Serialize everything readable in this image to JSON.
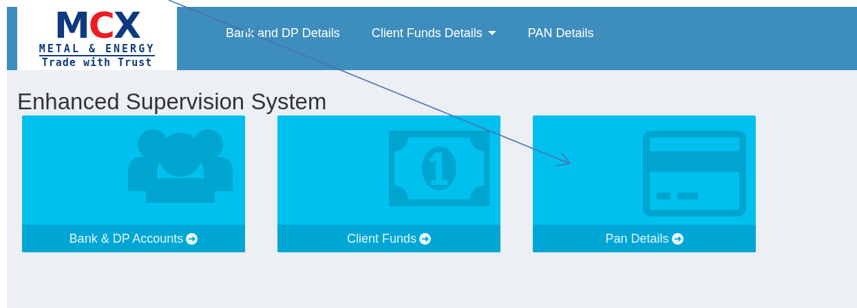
{
  "logo": {
    "letters": [
      {
        "text": "M",
        "color": "#0d3a7e"
      },
      {
        "text": "C",
        "color": "#ed1c24"
      },
      {
        "text": "X",
        "color": "#0d3a7e"
      }
    ],
    "subtitle": "METAL & ENERGY",
    "tagline": "Trade with Trust"
  },
  "nav": [
    {
      "label": "Bank and DP Details",
      "dropdown": false
    },
    {
      "label": "Client Funds Details",
      "dropdown": true
    },
    {
      "label": "PAN Details",
      "dropdown": false
    }
  ],
  "title": "Enhanced Supervision System",
  "tiles": [
    {
      "kind": "people",
      "label": "Bank & DP Accounts"
    },
    {
      "kind": "money",
      "label": "Client Funds"
    },
    {
      "kind": "card",
      "label": "Pan Details"
    }
  ]
}
